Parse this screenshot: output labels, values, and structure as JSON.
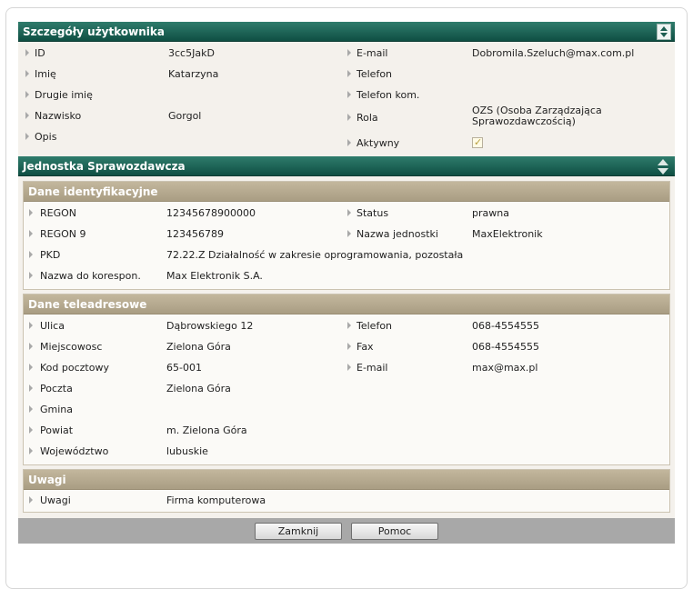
{
  "user_section": {
    "title": "Szczegóły użytkownika",
    "left": [
      {
        "label": "ID",
        "value": "3cc5JakD"
      },
      {
        "label": "Imię",
        "value": "Katarzyna"
      },
      {
        "label": "Drugie imię",
        "value": ""
      },
      {
        "label": "Nazwisko",
        "value": "Gorgol"
      },
      {
        "label": "Opis",
        "value": ""
      }
    ],
    "right": [
      {
        "label": "E-mail",
        "value": "Dobromila.Szeluch@max.com.pl"
      },
      {
        "label": "Telefon",
        "value": ""
      },
      {
        "label": "Telefon kom.",
        "value": ""
      },
      {
        "label": "Rola",
        "value": "OZS (Osoba Zarządzająca",
        "value2": "Sprawozdawczością)"
      },
      {
        "label": "Aktywny",
        "checked": true
      }
    ]
  },
  "unit_section": {
    "title": "Jednostka Sprawozdawcza",
    "identification": {
      "title": "Dane identyfikacyjne",
      "left": [
        {
          "label": "REGON",
          "value": "12345678900000"
        },
        {
          "label": "REGON 9",
          "value": "123456789"
        },
        {
          "label": "PKD",
          "value": "72.22.Z Działalność w zakresie oprogramowania, pozostała"
        },
        {
          "label": "Nazwa do korespon.",
          "value": "Max Elektronik S.A."
        }
      ],
      "right": [
        {
          "label": "Status",
          "value": "prawna"
        },
        {
          "label": "Nazwa jednostki",
          "value": "MaxElektronik"
        }
      ]
    },
    "contact": {
      "title": "Dane teleadresowe",
      "left": [
        {
          "label": "Ulica",
          "value": "Dąbrowskiego 12"
        },
        {
          "label": "Miejscowosc",
          "value": "Zielona Góra"
        },
        {
          "label": "Kod pocztowy",
          "value": "65-001"
        },
        {
          "label": "Poczta",
          "value": "Zielona Góra"
        },
        {
          "label": "Gmina",
          "value": ""
        },
        {
          "label": "Powiat",
          "value": "m. Zielona Góra"
        },
        {
          "label": "Województwo",
          "value": "lubuskie"
        }
      ],
      "right": [
        {
          "label": "Telefon",
          "value": "068-4554555"
        },
        {
          "label": "Fax",
          "value": "068-4554555"
        },
        {
          "label": "E-mail",
          "value": "max@max.pl"
        }
      ]
    },
    "notes": {
      "title": "Uwagi",
      "rows": [
        {
          "label": "Uwagi",
          "value": "Firma komputerowa"
        }
      ]
    }
  },
  "footer": {
    "close_label": "Zamknij",
    "help_label": "Pomoc"
  }
}
